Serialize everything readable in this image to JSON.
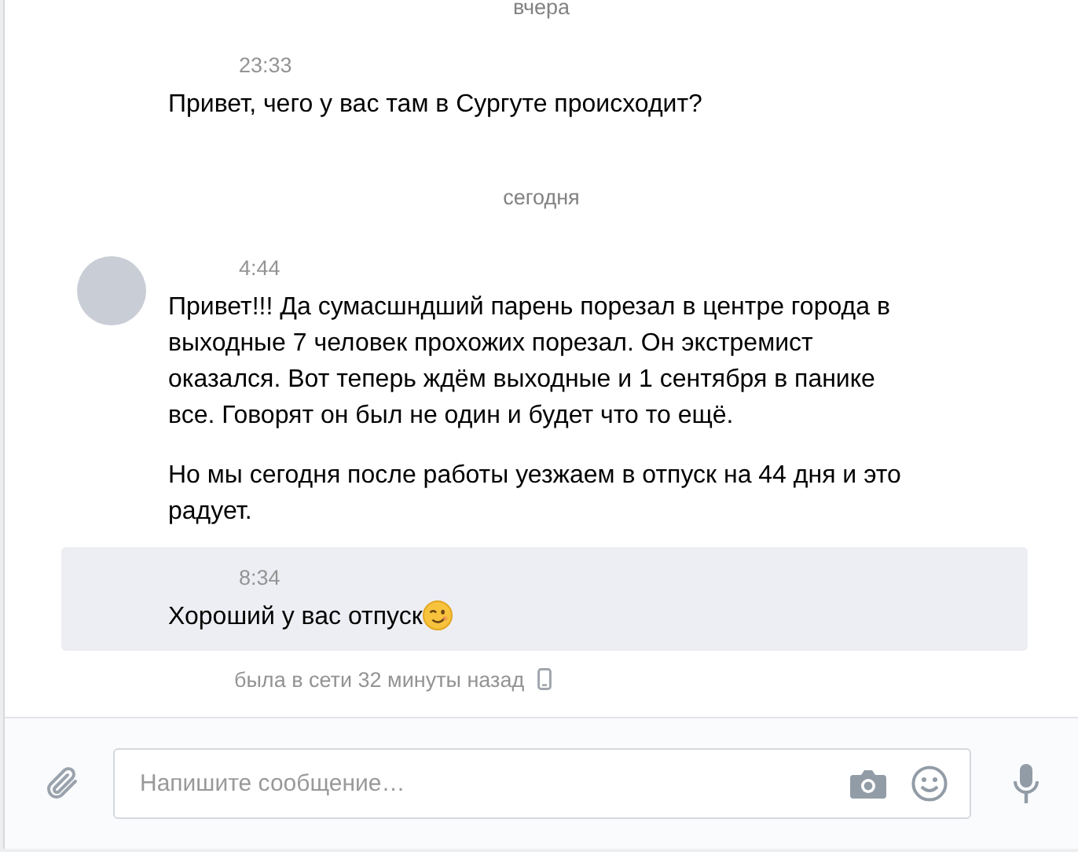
{
  "items": [
    {
      "kind": "date",
      "text": "вчера"
    },
    {
      "kind": "message",
      "avatar": false,
      "highlighted": false,
      "time": "23:33",
      "paragraphs": [
        "Привет, чего у вас там в Сургуте происходит?"
      ],
      "emoji": false
    },
    {
      "kind": "date",
      "text": "сегодня"
    },
    {
      "kind": "message",
      "avatar": true,
      "highlighted": false,
      "time": "4:44",
      "paragraphs": [
        "Привет!!! Да сумасшндший парень порезал в центре города в выходные 7 человек прохожих порезал. Он экстремист оказался. Вот теперь ждём выходные и 1 сентября в панике все. Говорят он был не один и будет что то ещё.",
        "Но мы сегодня после работы уезжаем в отпуск на 44 дня и это радует."
      ],
      "emoji": false
    },
    {
      "kind": "message",
      "avatar": false,
      "highlighted": true,
      "time": "8:34",
      "paragraphs": [
        "Хороший у вас отпуск"
      ],
      "emoji": true
    }
  ],
  "status": {
    "text": "была в сети 32 минуты назад"
  },
  "composer": {
    "placeholder": "Напишите сообщение…"
  }
}
